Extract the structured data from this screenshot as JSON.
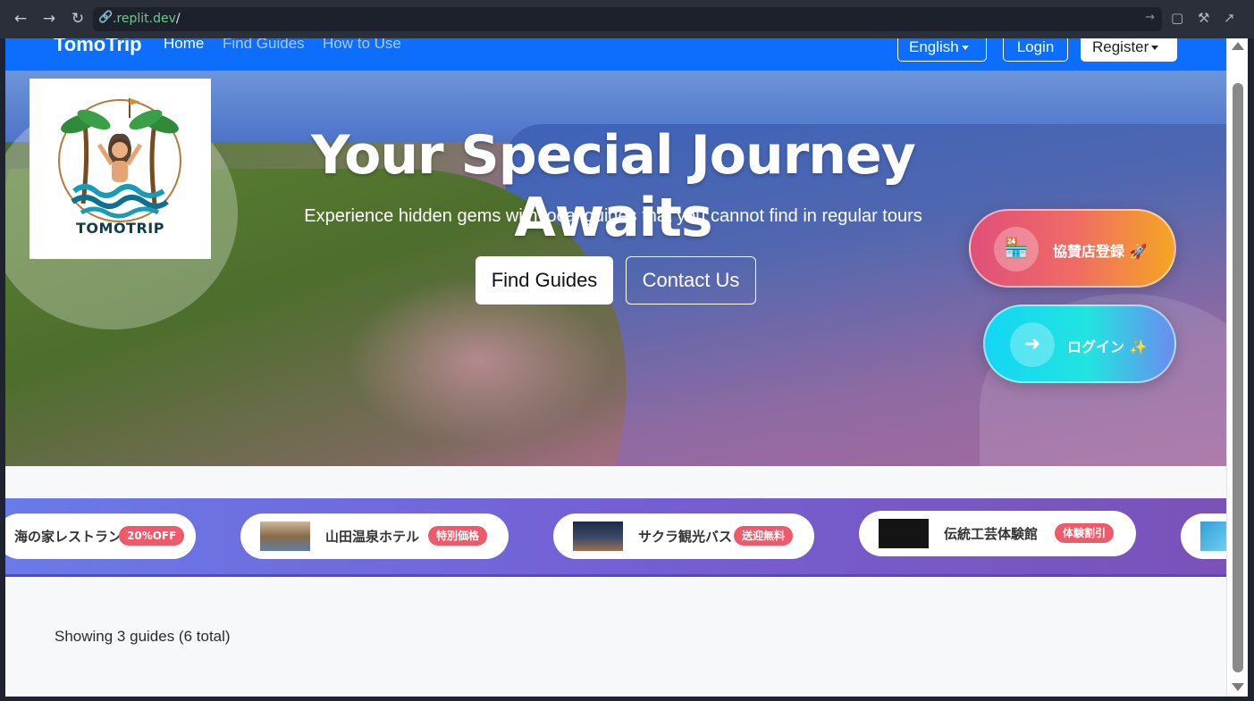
{
  "browser": {
    "url_domain": ".replit.dev",
    "url_path": "/"
  },
  "navbar": {
    "brand": "TomoTrip",
    "links": [
      "Home",
      "Find Guides",
      "How to Use"
    ],
    "language_label": "English",
    "login_label": "Login",
    "register_label": "Register"
  },
  "hero": {
    "logo_text": "TOMOTRIP",
    "title": "Your Special Journey Awaits",
    "subtitle": "Experience hidden gems with local guides that you cannot find in regular tours",
    "find_button": "Find Guides",
    "contact_button": "Contact Us",
    "sponsor_pill": "協賛店登録 🚀",
    "login_pill": "ログイン ✨"
  },
  "sponsors": [
    {
      "name": "海の家レストラン",
      "badge": "20%OFF"
    },
    {
      "name": "山田温泉ホテル",
      "badge": "特別価格"
    },
    {
      "name": "サクラ観光バス",
      "badge": "送迎無料"
    },
    {
      "name": "伝統工芸体験館",
      "badge": "体験割引"
    }
  ],
  "results": {
    "showing_text": "Showing 3 guides (6 total)"
  },
  "colors": {
    "navbar": "#0d6efd",
    "badge": "#ef5a6a",
    "ticker_start": "#6a7ae8",
    "ticker_end": "#7a52b8"
  }
}
